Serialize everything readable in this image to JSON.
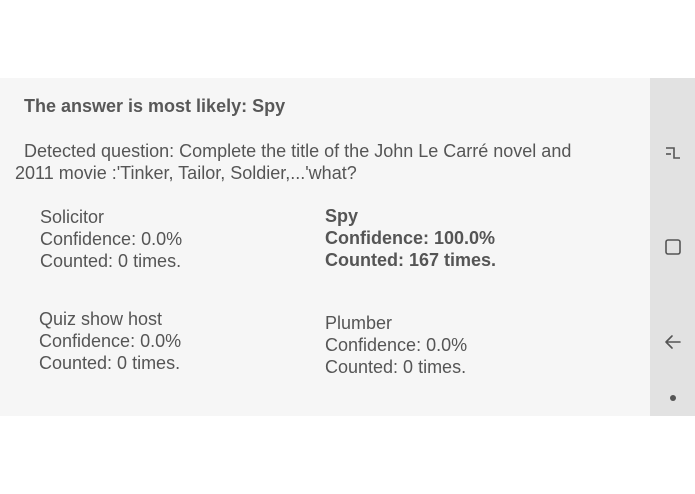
{
  "result": {
    "headline": "The answer is most likely: Spy",
    "question": "Detected question: Complete the title of the John Le Carré novel and 2011 movie :'Tinker, Tailor, Soldier,...'what?"
  },
  "answers": [
    {
      "name": "Solicitor",
      "confidence": "Confidence: 0.0%",
      "counted": "Counted: 0 times."
    },
    {
      "name": "Spy",
      "confidence": "Confidence: 100.0%",
      "counted": "Counted: 167 times."
    },
    {
      "name": "Quiz show host",
      "confidence": "Confidence: 0.0%",
      "counted": "Counted: 0 times."
    },
    {
      "name": "Plumber",
      "confidence": "Confidence: 0.0%",
      "counted": "Counted: 0 times."
    }
  ],
  "navbar": {
    "icons": [
      "recent-apps-icon",
      "home-icon",
      "back-icon",
      "dot-icon"
    ]
  },
  "colors": {
    "text": "#555555",
    "background": "#f6f6f6",
    "navbar": "#e2e2e2"
  }
}
